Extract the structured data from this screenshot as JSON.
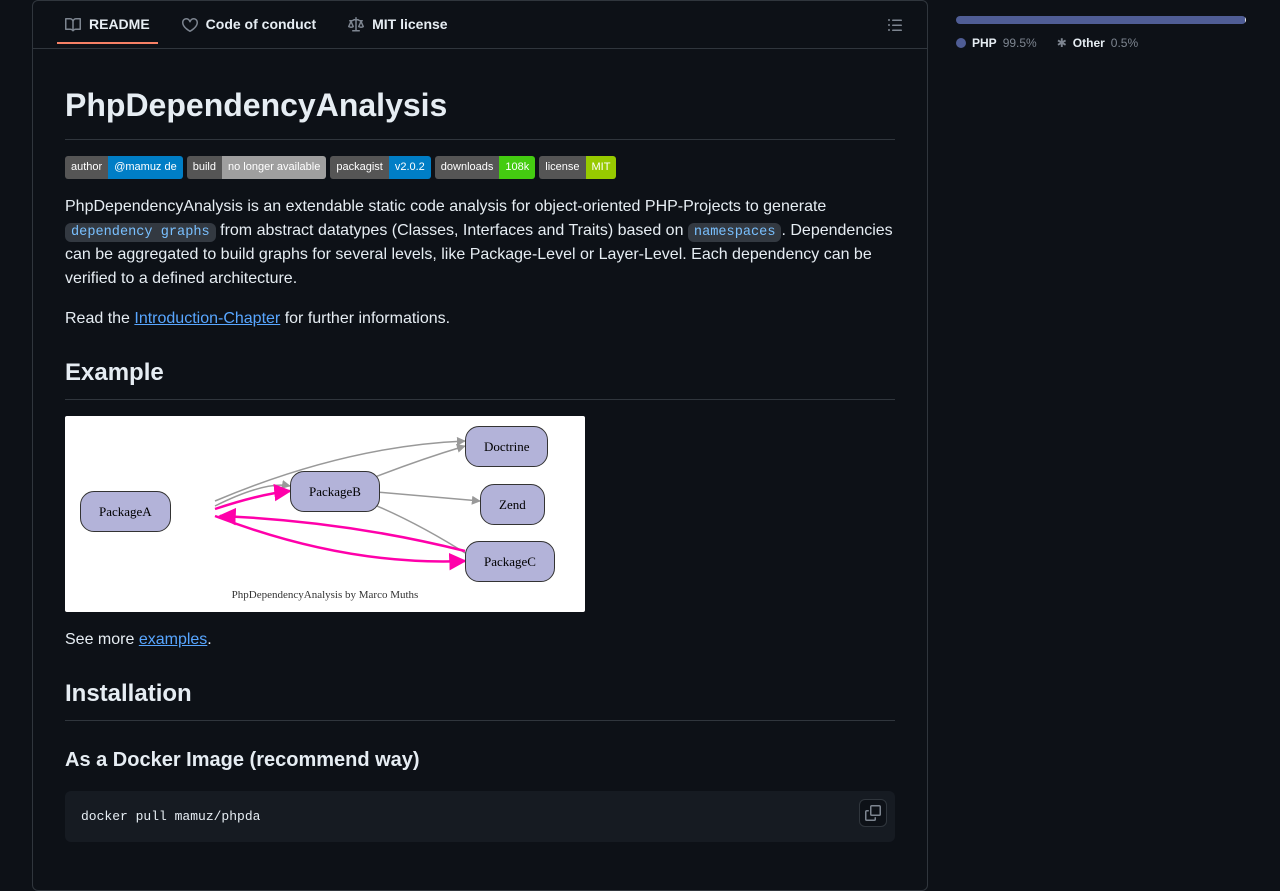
{
  "tabs": {
    "readme": "README",
    "coc": "Code of conduct",
    "license": "MIT license"
  },
  "title": "PhpDependencyAnalysis",
  "badges": [
    {
      "left": "author",
      "right": "@mamuz de",
      "color": "br-blue"
    },
    {
      "left": "build",
      "right": "no longer available",
      "color": "br-grey"
    },
    {
      "left": "packagist",
      "right": "v2.0.2",
      "color": "br-blue"
    },
    {
      "left": "downloads",
      "right": "108k",
      "color": "br-brightgreen"
    },
    {
      "left": "license",
      "right": "MIT",
      "color": "br-green"
    }
  ],
  "para1": {
    "pre": "PhpDependencyAnalysis is an extendable static code analysis for object-oriented PHP-Projects to generate ",
    "code1": "dependency graphs",
    "mid": " from abstract datatypes (Classes, Interfaces and Traits) based on ",
    "code2": "namespaces",
    "post": ". Dependencies can be aggregated to build graphs for several levels, like Package-Level or Layer-Level. Each dependency can be verified to a defined architecture."
  },
  "para2": {
    "pre": "Read the ",
    "link": "Introduction-Chapter",
    "post": " for further informations."
  },
  "h2_example": "Example",
  "diagram": {
    "nodes": {
      "packageA": "PackageA",
      "packageB": "PackageB",
      "doctrine": "Doctrine",
      "zend": "Zend",
      "packageC": "PackageC"
    },
    "caption": "PhpDependencyAnalysis by Marco Muths"
  },
  "para3": {
    "pre": "See more ",
    "link": "examples",
    "post": "."
  },
  "h2_install": "Installation",
  "h3_docker": "As a Docker Image (recommend way)",
  "codeblock": "docker pull mamuz/phpda",
  "languages": {
    "php": {
      "name": "PHP",
      "pct": "99.5%",
      "color": "#4F5D95"
    },
    "other": {
      "name": "Other",
      "pct": "0.5%",
      "color": "#ededed"
    }
  }
}
